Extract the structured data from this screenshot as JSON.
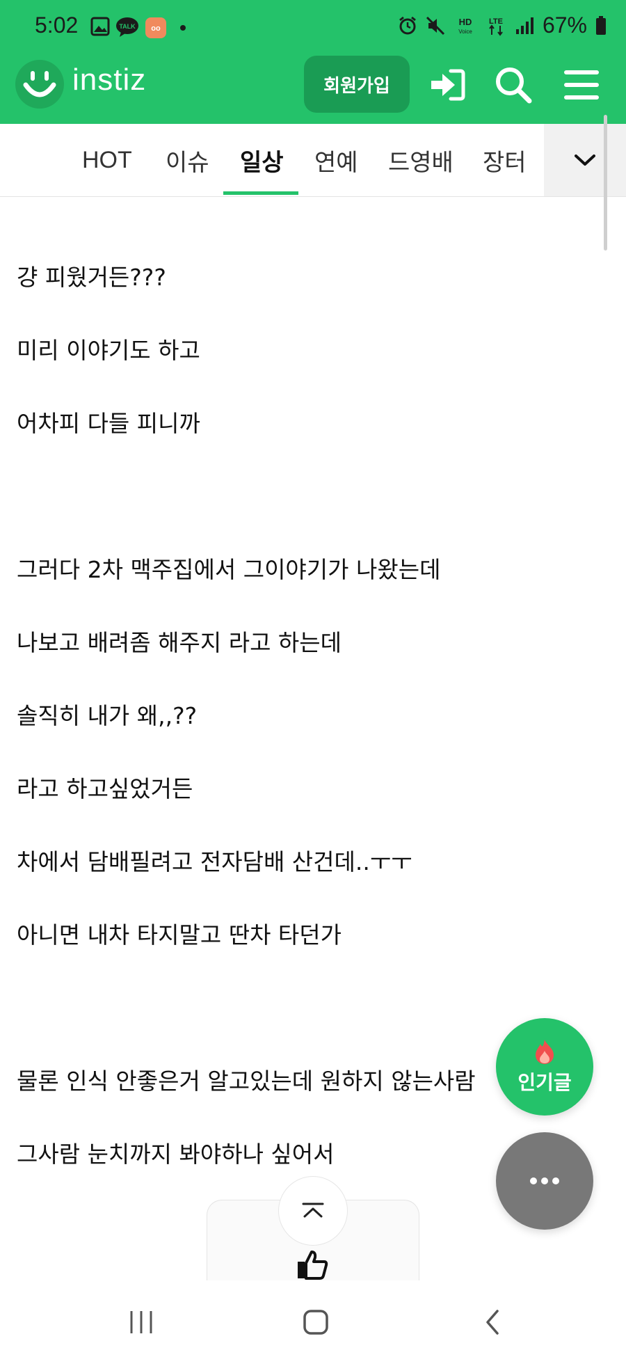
{
  "status_bar": {
    "time": "5:02",
    "battery": "67%",
    "icons": [
      "gallery-icon",
      "kakaotalk-icon",
      "app-notification-icon",
      "dot-icon",
      "alarm-icon",
      "mute-icon",
      "hd-voice-icon",
      "lte-icon",
      "signal-icon",
      "battery-icon"
    ]
  },
  "header": {
    "logo_text": "instiz",
    "join_label": "회원가입",
    "icons": [
      "login-icon",
      "search-icon",
      "menu-icon"
    ]
  },
  "tabs": {
    "items": [
      "HOT",
      "이슈",
      "일상",
      "연예",
      "드영배",
      "장터"
    ],
    "active": "일상"
  },
  "post": {
    "lines": [
      "걍 피웠거든???",
      "미리 이야기도 하고",
      "어차피 다들 피니까",
      "그러다 2차 맥주집에서 그이야기가 나왔는데",
      "나보고 배려좀 해주지 라고 하는데",
      "솔직히 내가 왜,,??",
      "라고 하고싶었거든",
      "차에서 담배필려고 전자담배 산건데..ㅜㅜ",
      "아니면 내차 타지말고 딴차 타던가",
      "물론 인식 안좋은거 알고있는데 원하지 않는사람",
      "그사람 눈치까지 봐야하나 싶어서"
    ]
  },
  "floating": {
    "hot_label": "인기글"
  },
  "colors": {
    "brand_green": "#24c26a",
    "dark_green": "#1a9c54",
    "gray_fab": "#787878"
  }
}
